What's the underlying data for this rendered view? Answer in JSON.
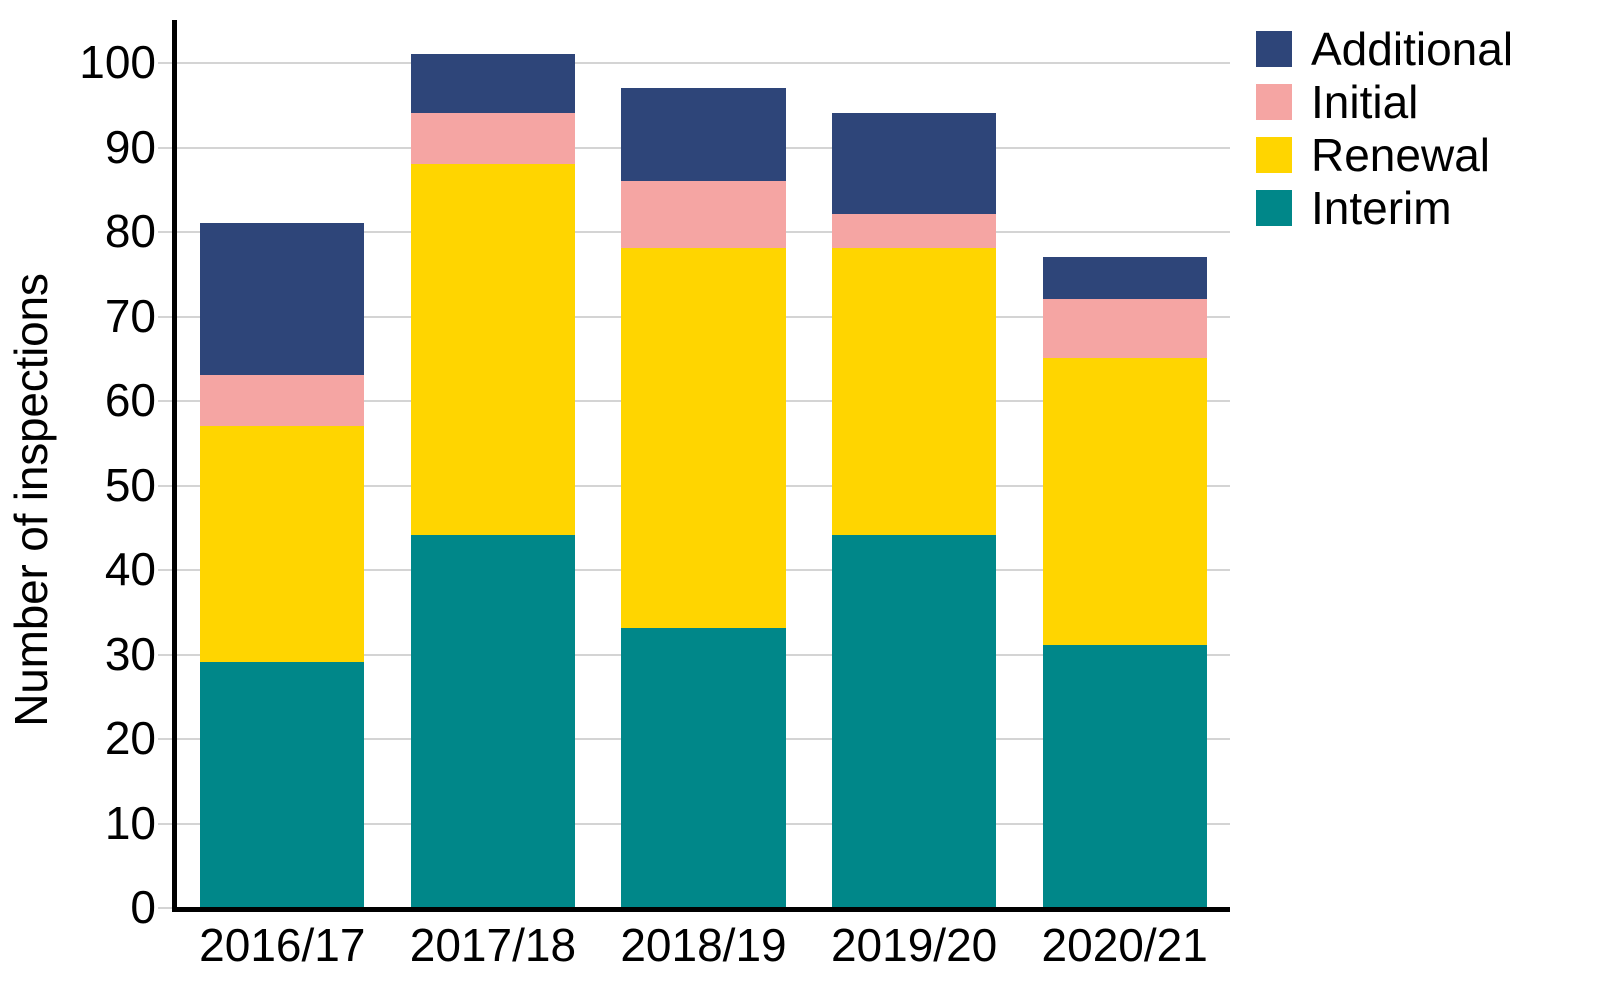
{
  "chart_data": {
    "type": "bar",
    "stacked": true,
    "title": "",
    "xlabel": "",
    "ylabel": "Number of inspections",
    "categories": [
      "2016/17",
      "2017/18",
      "2018/19",
      "2019/20",
      "2020/21"
    ],
    "series": [
      {
        "name": "Interim",
        "color": "#008789",
        "values": [
          29,
          44,
          33,
          44,
          31
        ]
      },
      {
        "name": "Renewal",
        "color": "#FFD500",
        "values": [
          28,
          44,
          45,
          34,
          34
        ]
      },
      {
        "name": "Initial",
        "color": "#F5A5A3",
        "values": [
          6,
          6,
          8,
          4,
          7
        ]
      },
      {
        "name": "Additional",
        "color": "#2E4579",
        "values": [
          18,
          7,
          11,
          12,
          5
        ]
      }
    ],
    "totals": [
      81,
      101,
      97,
      94,
      77
    ],
    "ylim": [
      0,
      105
    ],
    "yticks": [
      0,
      10,
      20,
      30,
      40,
      50,
      60,
      70,
      80,
      90,
      100
    ],
    "ytick_labels": [
      "0",
      "10",
      "20",
      "30",
      "40",
      "50",
      "60",
      "70",
      "80",
      "90",
      "100"
    ],
    "grid": true,
    "grid_axis": "y",
    "legend": {
      "position": "right-top",
      "entries": [
        {
          "label": "Additional",
          "color": "#2E4579"
        },
        {
          "label": "Initial",
          "color": "#F5A5A3"
        },
        {
          "label": "Renewal",
          "color": "#FFD500"
        },
        {
          "label": "Interim",
          "color": "#008789"
        }
      ]
    }
  }
}
